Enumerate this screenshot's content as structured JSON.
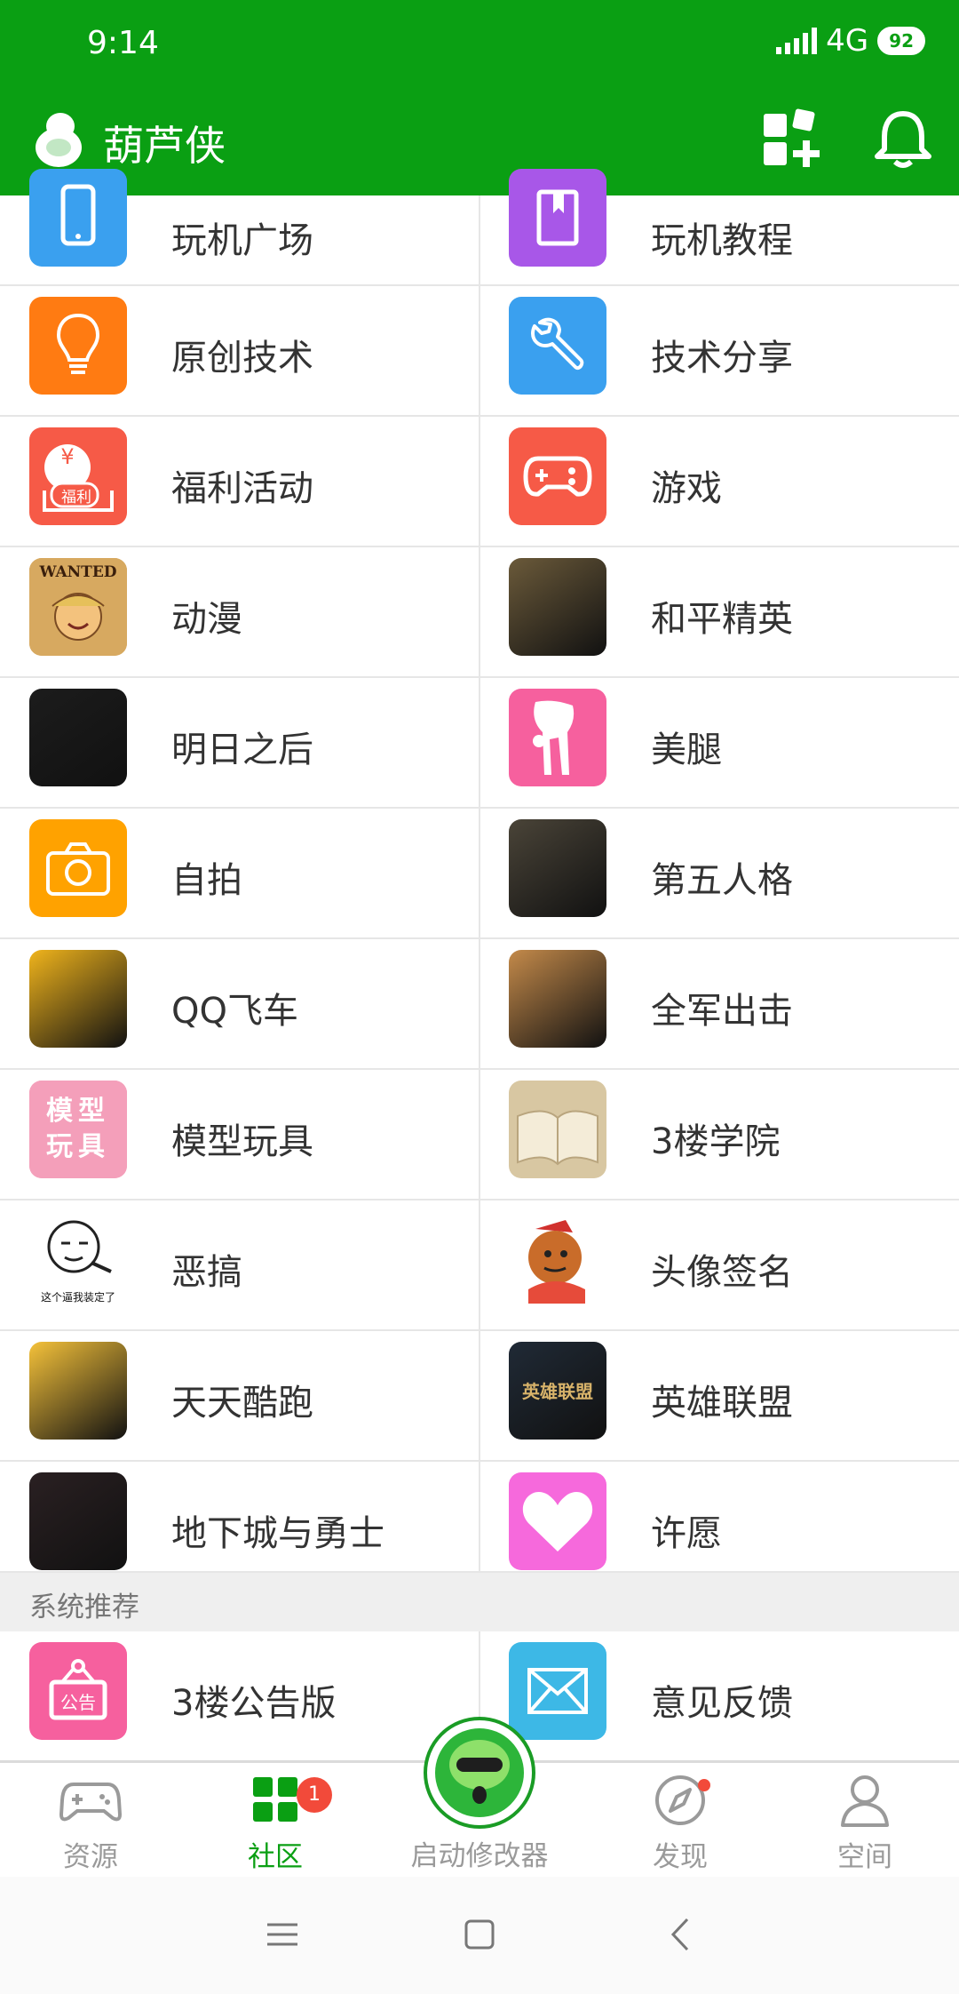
{
  "status_bar": {
    "time": "9:14",
    "network": "4G",
    "battery": "92"
  },
  "header": {
    "title": "葫芦侠"
  },
  "colors": {
    "brand": "#0a9f13",
    "badge": "#f24a3a"
  },
  "categories": [
    {
      "left": {
        "label": "玩机广场",
        "icon": "phone-icon",
        "color": "#3aa0ef"
      },
      "right": {
        "label": "玩机教程",
        "icon": "book-icon",
        "color": "#a857e8"
      }
    },
    {
      "left": {
        "label": "原创技术",
        "icon": "lightbulb-icon",
        "color": "#ff7b12"
      },
      "right": {
        "label": "技术分享",
        "icon": "wrench-icon",
        "color": "#3aa0ef"
      }
    },
    {
      "left": {
        "label": "福利活动",
        "icon": "welfare-icon",
        "color": "#f65a47",
        "icon_text": "福利"
      },
      "right": {
        "label": "游戏",
        "icon": "gamepad-icon",
        "color": "#f65a47"
      }
    },
    {
      "left": {
        "label": "动漫",
        "icon": "anime-poster-icon",
        "color": "#d7a960",
        "icon_text": "WANTED"
      },
      "right": {
        "label": "和平精英",
        "icon": "game-art-icon",
        "color": "#6b5a3a"
      }
    },
    {
      "left": {
        "label": "明日之后",
        "icon": "game-art-icon",
        "color": "#1c1c1c"
      },
      "right": {
        "label": "美腿",
        "icon": "legs-icon",
        "color": "#f6609e"
      }
    },
    {
      "left": {
        "label": "自拍",
        "icon": "camera-icon",
        "color": "#ffa200"
      },
      "right": {
        "label": "第五人格",
        "icon": "game-art-icon",
        "color": "#4a4438"
      }
    },
    {
      "left": {
        "label": "QQ飞车",
        "icon": "game-art-icon",
        "color": "#f0b41c"
      },
      "right": {
        "label": "全军出击",
        "icon": "game-art-icon",
        "color": "#c48a4a"
      }
    },
    {
      "left": {
        "label": "模型玩具",
        "icon": "model-toy-icon",
        "color": "#f49fba",
        "icon_text": "模型玩具"
      },
      "right": {
        "label": "3楼学院",
        "icon": "open-book-icon",
        "color": "#d8c7a2"
      }
    },
    {
      "left": {
        "label": "恶搞",
        "icon": "meme-face-icon",
        "color": "#ffffff",
        "icon_text": "这个逼我装定了"
      },
      "right": {
        "label": "头像签名",
        "icon": "cartoon-avatar-icon",
        "color": "#ffffff"
      }
    },
    {
      "left": {
        "label": "天天酷跑",
        "icon": "game-art-icon",
        "color": "#f5c23a"
      },
      "right": {
        "label": "英雄联盟",
        "icon": "game-art-icon",
        "color": "#202a36",
        "icon_text": "英雄联盟"
      }
    },
    {
      "left": {
        "label": "地下城与勇士",
        "icon": "game-art-icon",
        "color": "#2a2022"
      },
      "right": {
        "label": "许愿",
        "icon": "heart-icon",
        "color": "#f669dc"
      }
    }
  ],
  "section": {
    "title": "系统推荐"
  },
  "system": {
    "left": {
      "label": "3楼公告版",
      "icon": "notice-board-icon",
      "color": "#f6609e",
      "icon_text": "公告"
    },
    "right": {
      "label": "意见反馈",
      "icon": "envelope-icon",
      "color": "#3db8e6"
    }
  },
  "tabbar": {
    "tabs": [
      {
        "label": "资源",
        "icon": "gamepad-outline-icon"
      },
      {
        "label": "社区",
        "icon": "grid-icon",
        "badge": "1",
        "active": true
      },
      {
        "label": "发现",
        "icon": "compass-icon",
        "dot": true
      },
      {
        "label": "空间",
        "icon": "person-icon"
      }
    ],
    "center": {
      "label": "启动修改器",
      "icon": "huluxia-mascot-icon"
    }
  },
  "navbar": {
    "buttons": [
      "menu-icon",
      "home-icon",
      "back-icon"
    ]
  }
}
